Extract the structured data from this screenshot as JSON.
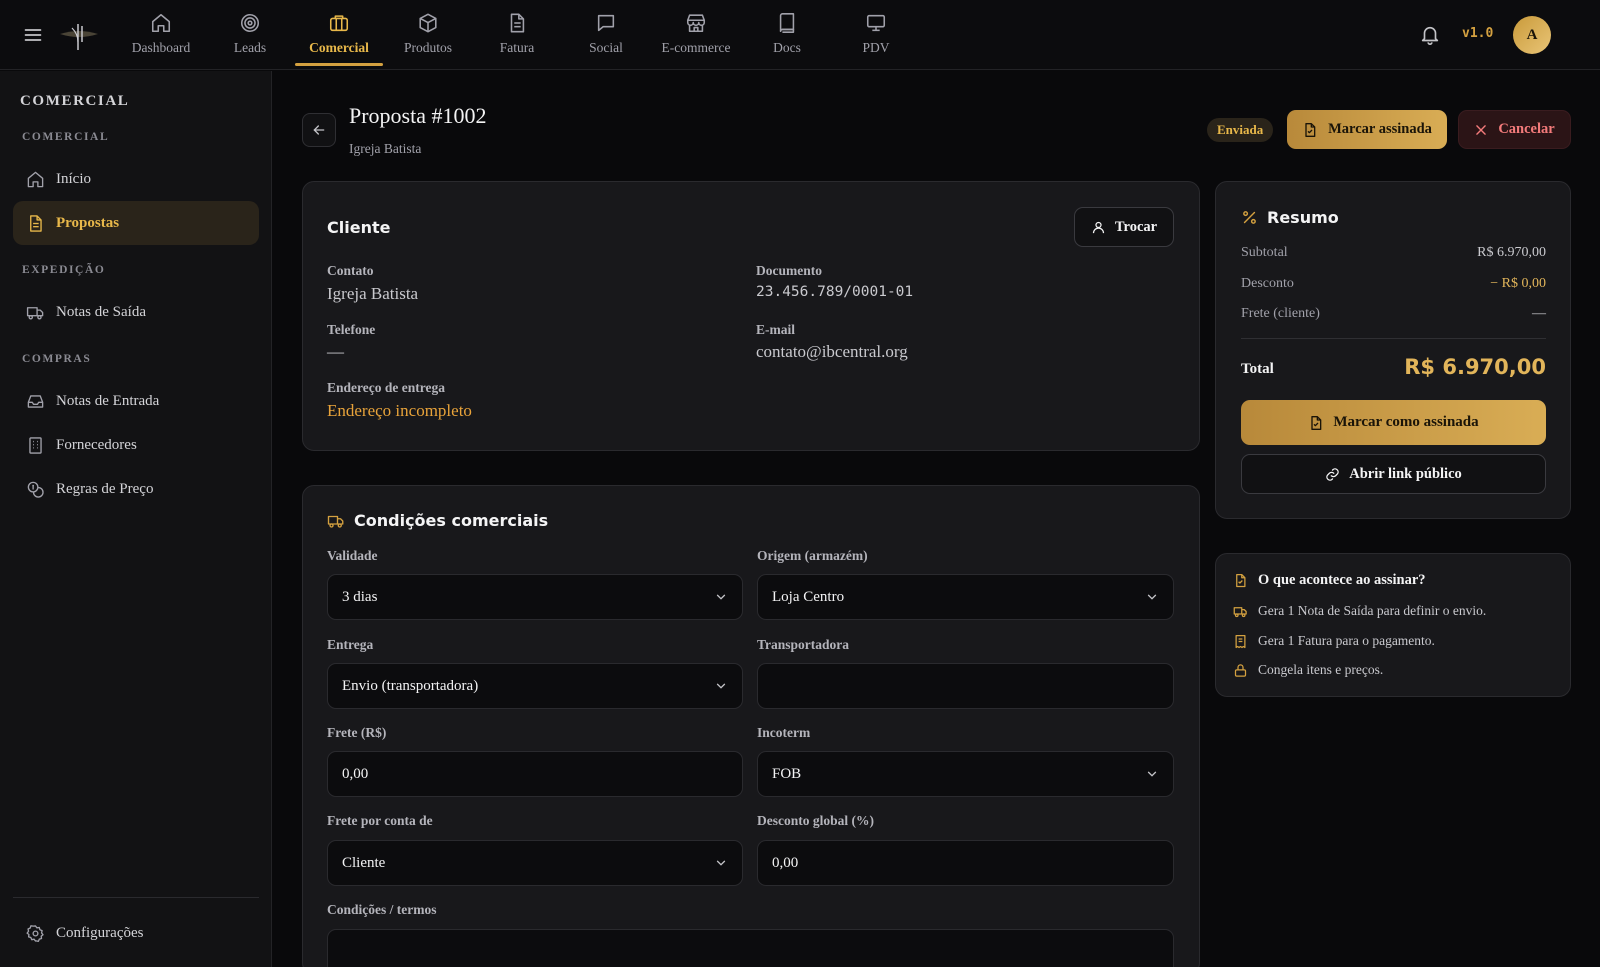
{
  "topbar": {
    "nav": [
      {
        "label": "Dashboard",
        "icon": "home-icon"
      },
      {
        "label": "Leads",
        "icon": "target-icon"
      },
      {
        "label": "Comercial",
        "icon": "briefcase-icon",
        "active": true
      },
      {
        "label": "Produtos",
        "icon": "box-icon"
      },
      {
        "label": "Fatura",
        "icon": "file-text-icon"
      },
      {
        "label": "Social",
        "icon": "message-square-icon"
      },
      {
        "label": "E-commerce",
        "icon": "store-icon"
      },
      {
        "label": "Docs",
        "icon": "book-icon"
      },
      {
        "label": "PDV",
        "icon": "monitor-icon"
      }
    ],
    "version": "v1.0",
    "avatar_initial": "A"
  },
  "sidebar": {
    "title": "COMERCIAL",
    "groups": {
      "comercial": "COMERCIAL",
      "expedicao": "EXPEDIÇÃO",
      "compras": "COMPRAS"
    },
    "items": {
      "inicio": "Início",
      "propostas": "Propostas",
      "notas_saida": "Notas de Saída",
      "notas_entrada": "Notas de Entrada",
      "fornecedores": "Fornecedores",
      "regras_preco": "Regras de Preço",
      "configuracoes": "Configurações"
    }
  },
  "header": {
    "title": "Proposta #1002",
    "subtitle": "Igreja Batista",
    "status": "Enviada",
    "mark_signed": "Marcar assinada",
    "cancel": "Cancelar"
  },
  "cliente": {
    "title": "Cliente",
    "swap_button": "Trocar",
    "contato_label": "Contato",
    "contato": "Igreja Batista",
    "documento_label": "Documento",
    "documento": "23.456.789/0001-01",
    "telefone_label": "Telefone",
    "telefone": "—",
    "email_label": "E-mail",
    "email": "contato@ibcentral.org",
    "endereco_label": "Endereço de entrega",
    "endereco": "Endereço incompleto"
  },
  "condicoes": {
    "title": "Condições comerciais",
    "validade_label": "Validade",
    "validade": "3 dias",
    "origem_label": "Origem (armazém)",
    "origem": "Loja Centro",
    "entrega_label": "Entrega",
    "entrega": "Envio (transportadora)",
    "transportadora_label": "Transportadora",
    "transportadora": "",
    "frete_label": "Frete (R$)",
    "frete": "0,00",
    "incoterm_label": "Incoterm",
    "incoterm": "FOB",
    "frete_conta_label": "Frete por conta de",
    "frete_conta": "Cliente",
    "desconto_label": "Desconto global (%)",
    "desconto": "0,00",
    "termos_label": "Condições / termos"
  },
  "resumo": {
    "title": "Resumo",
    "subtotal_label": "Subtotal",
    "subtotal": "R$ 6.970,00",
    "desconto_label": "Desconto",
    "desconto": "− R$ 0,00",
    "frete_label": "Frete (cliente)",
    "frete": "—",
    "total_label": "Total",
    "total": "R$ 6.970,00",
    "mark_signed": "Marcar como assinada",
    "open_link": "Abrir link público"
  },
  "info": {
    "title": "O que acontece ao assinar?",
    "items": [
      "Gera 1 Nota de Saída para definir o envio.",
      "Gera 1 Fatura para o pagamento.",
      "Congela itens e preços."
    ]
  },
  "colors": {
    "accent": "#d4a140",
    "background": "#09090b",
    "card": "#18181b",
    "danger": "#f47b7b",
    "warning": "#e8a33a"
  }
}
